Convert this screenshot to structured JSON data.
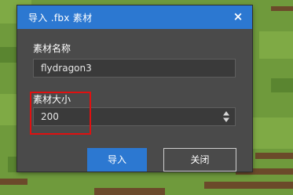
{
  "dialog": {
    "title": "导入 .fbx 素材",
    "close_symbol": "×",
    "name_label": "素材名称",
    "name_value": "flydragon3",
    "size_label": "素材大小",
    "size_value": "200",
    "spinner_icon": "updown-arrows-icon",
    "import_label": "导入",
    "close_label": "关闭"
  },
  "colors": {
    "accent": "#2c78d1",
    "dialog_bg": "#4a4a4a",
    "highlight": "#e01010",
    "grass": "#6f9a3c"
  }
}
